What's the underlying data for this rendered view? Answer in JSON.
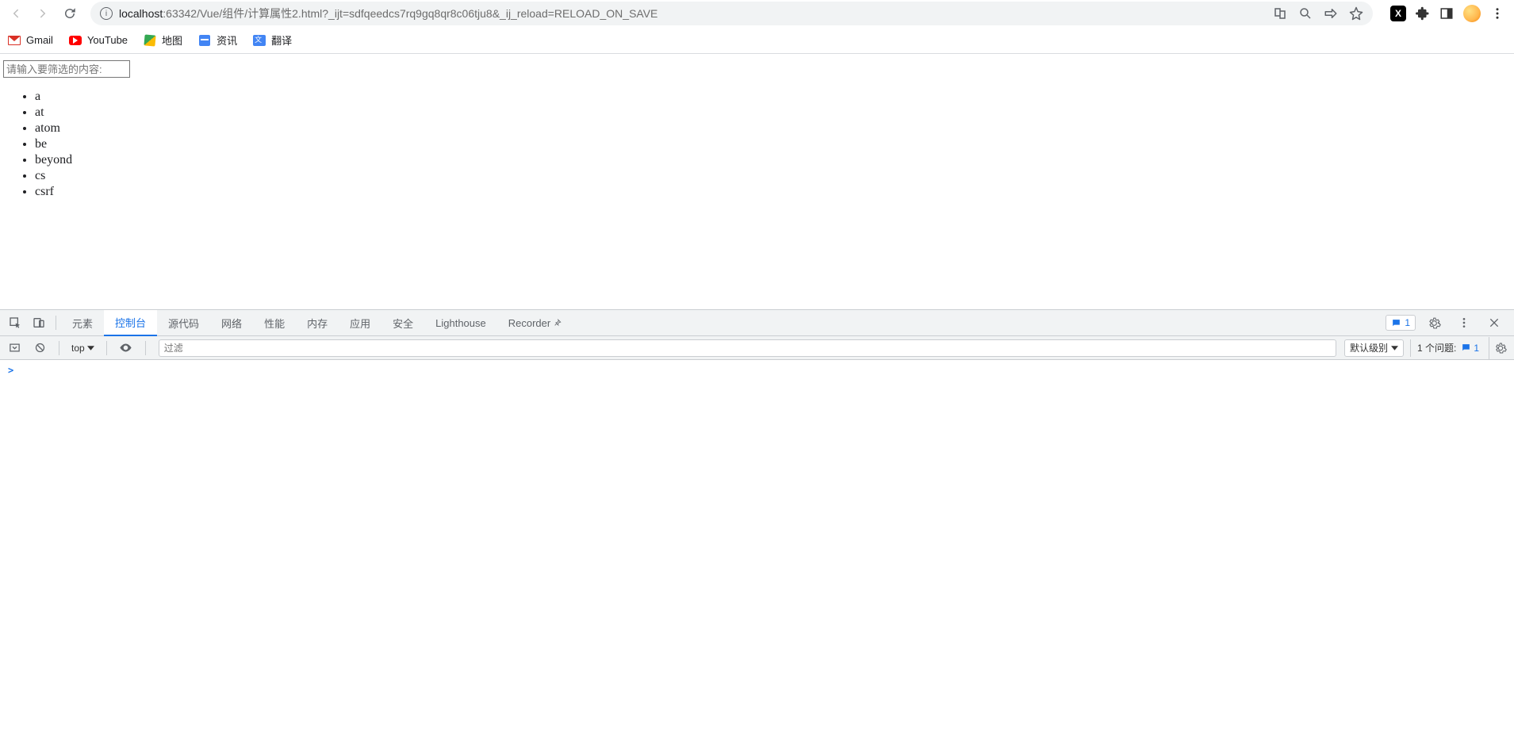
{
  "browser": {
    "url_host": "localhost",
    "url_rest": ":63342/Vue/组件/计算属性2.html?_ijt=sdfqeedcs7rq9gq8qr8c06tju8&_ij_reload=RELOAD_ON_SAVE"
  },
  "bookmarks": [
    {
      "label": "Gmail"
    },
    {
      "label": "YouTube"
    },
    {
      "label": "地图"
    },
    {
      "label": "资讯"
    },
    {
      "label": "翻译"
    }
  ],
  "page": {
    "filter_placeholder": "请输入要筛选的内容:",
    "items": [
      "a",
      "at",
      "atom",
      "be",
      "beyond",
      "cs",
      "csrf"
    ]
  },
  "devtools": {
    "tabs": [
      "元素",
      "控制台",
      "源代码",
      "网络",
      "性能",
      "内存",
      "应用",
      "安全",
      "Lighthouse",
      "Recorder"
    ],
    "active_tab_index": 1,
    "errors_badge": "1",
    "console": {
      "context": "top",
      "filter_placeholder": "过滤",
      "level": "默认级别",
      "issues_label": "1 个问题:",
      "issues_count": "1",
      "prompt": ">"
    }
  }
}
